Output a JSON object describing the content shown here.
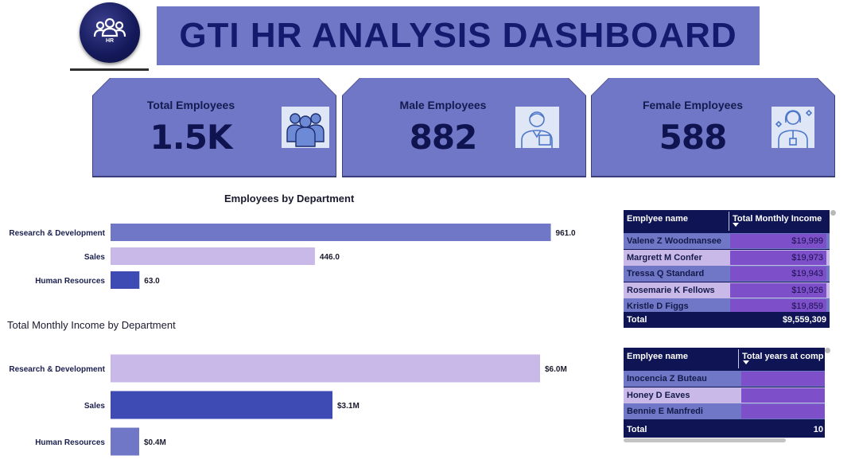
{
  "header": {
    "title": "GTI HR ANALYSIS DASHBOARD",
    "logo_text": "HR"
  },
  "colors": {
    "banner": "#7077c6",
    "title_text": "#141b6e",
    "bar_dark": "#3f4bb5",
    "bar_mid": "#7077c6",
    "bar_light": "#c9b9e8",
    "table_header": "#0e1454",
    "table_value": "#7d4fc9"
  },
  "kpis": [
    {
      "label": "Total Employees",
      "value": "1.5K",
      "icon": "team-icon"
    },
    {
      "label": "Male Employees",
      "value": "882",
      "icon": "male-employee-icon"
    },
    {
      "label": "Female Employees",
      "value": "588",
      "icon": "female-employee-icon"
    }
  ],
  "chart_data": [
    {
      "type": "bar",
      "orientation": "horizontal",
      "title": "Employees by Department",
      "categories": [
        "Research & Development",
        "Sales",
        "Human Resources"
      ],
      "values": [
        961,
        446,
        63
      ],
      "data_labels": [
        "961.0",
        "446.0",
        "63.0"
      ],
      "bar_colors": [
        "#7077c6",
        "#c9b9e8",
        "#3f4bb5"
      ],
      "xlim": [
        0,
        1000
      ]
    },
    {
      "type": "bar",
      "orientation": "horizontal",
      "title": "Total Monthly Income by Department",
      "categories": [
        "Research & Development",
        "Sales",
        "Human Resources"
      ],
      "values": [
        6.0,
        3.1,
        0.4
      ],
      "data_labels": [
        "$6.0M",
        "$3.1M",
        "$0.4M"
      ],
      "bar_colors": [
        "#c9b9e8",
        "#3f4bb5",
        "#7077c6"
      ],
      "xlim": [
        0,
        7.2
      ]
    }
  ],
  "income_table": {
    "columns": [
      "Emplyee name",
      "Total Monthly Income"
    ],
    "rows": [
      {
        "name": "Valene Z Woodmansee",
        "value": "$19,999"
      },
      {
        "name": "Margrett M Confer",
        "value": "$19,973"
      },
      {
        "name": "Tressa Q Standard",
        "value": "$19,943"
      },
      {
        "name": "Rosemarie K Fellows",
        "value": "$19,926"
      },
      {
        "name": "Kristle D Figgs",
        "value": "$19,859"
      }
    ],
    "total_label": "Total",
    "total_value": "$9,559,309"
  },
  "years_table": {
    "columns": [
      "Emplyee name",
      "Total years at comp"
    ],
    "rows": [
      {
        "name": "Inocencia Z Buteau",
        "value": ""
      },
      {
        "name": "Honey D Eaves",
        "value": ""
      },
      {
        "name": "Bennie E Manfredi",
        "value": ""
      }
    ],
    "total_label": "Total",
    "total_value": "10"
  }
}
